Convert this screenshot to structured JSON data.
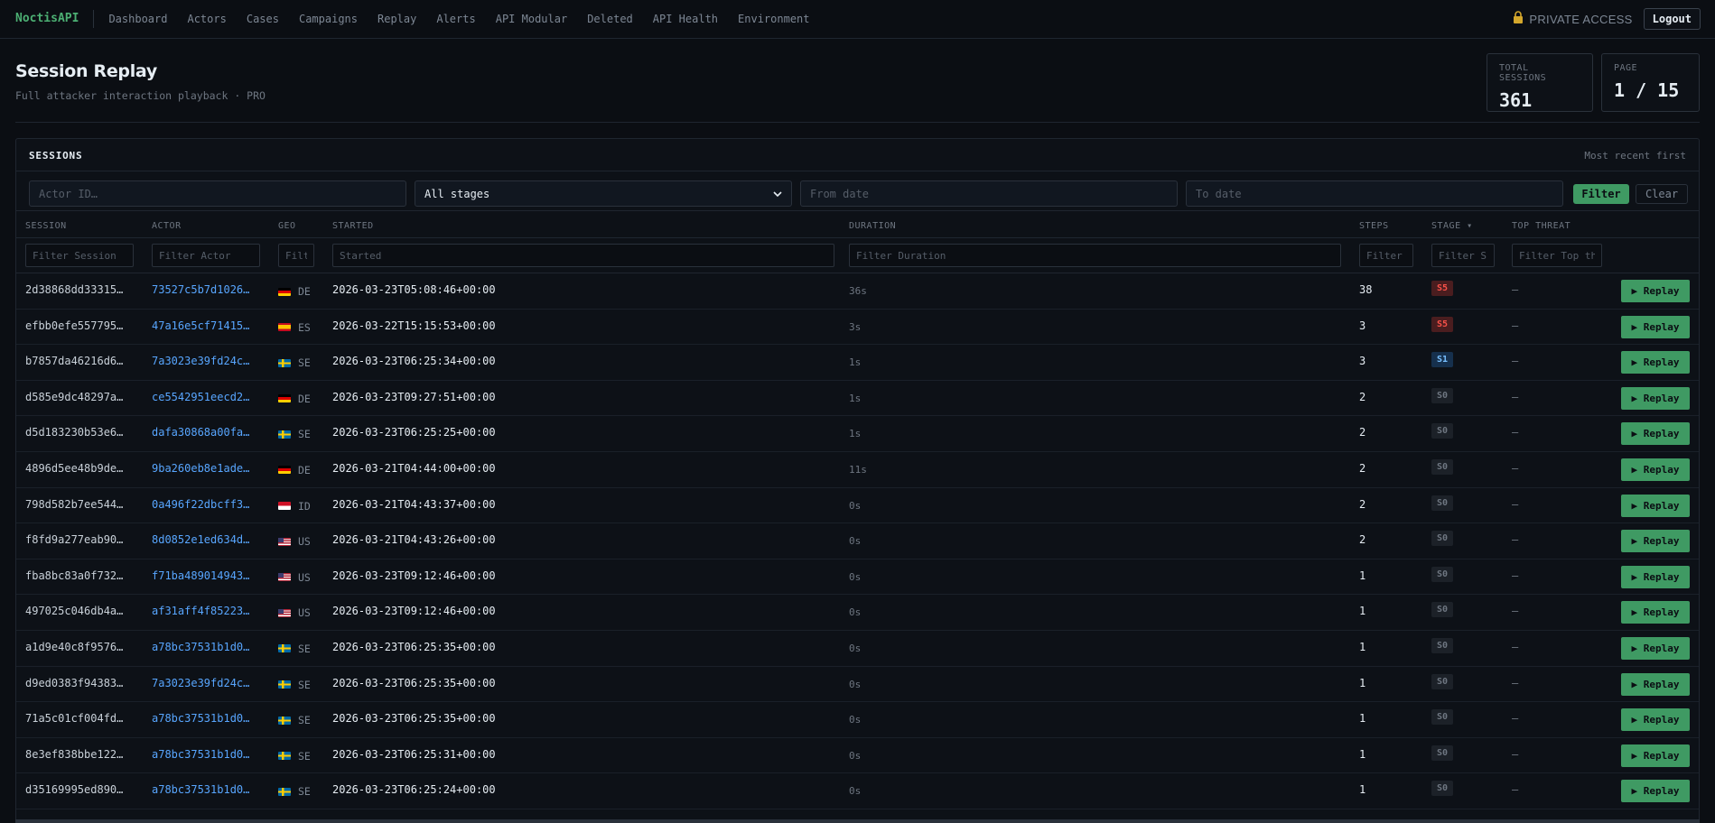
{
  "nav": {
    "brand": "NoctisAPI",
    "links": [
      "Dashboard",
      "Actors",
      "Cases",
      "Campaigns",
      "Replay",
      "Alerts",
      "API Modular",
      "Deleted",
      "API Health",
      "Environment"
    ],
    "private_label": "PRIVATE ACCESS",
    "logout_label": "Logout"
  },
  "header": {
    "title": "Session Replay",
    "subtitle": "Full attacker interaction playback · PRO",
    "total_sessions_label": "TOTAL SESSIONS",
    "total_sessions_value": "361",
    "page_label": "PAGE",
    "page_value": "1 / 15"
  },
  "panel": {
    "title": "SESSIONS",
    "note": "Most recent first",
    "actor_placeholder": "Actor ID…",
    "stage_select": "All stages",
    "from_placeholder": "From date",
    "to_placeholder": "To date",
    "filter_label": "Filter",
    "clear_label": "Clear"
  },
  "table": {
    "headers": {
      "session": "SESSION",
      "actor": "ACTOR",
      "geo": "GEO",
      "started": "STARTED",
      "duration": "DURATION",
      "steps": "STEPS",
      "stage": "STAGE ▾",
      "top_threat": "TOP THREAT"
    },
    "column_filters": {
      "session": "Filter Session",
      "actor": "Filter Actor",
      "geo": "Filt",
      "started": "Started",
      "duration": "Filter Duration",
      "steps": "Filter",
      "stage": "Filter S",
      "top_threat": "Filter Top th"
    },
    "replay_label": "▶ Replay",
    "rows": [
      {
        "session": "2d38868dd33315…",
        "actor": "73527c5b7d1026…",
        "geo": "DE",
        "started": "2026-03-23T05:08:46+00:00",
        "duration": "36s",
        "steps": "38",
        "stage": "S5",
        "threat": "—"
      },
      {
        "session": "efbb0efe557795…",
        "actor": "47a16e5cf71415…",
        "geo": "ES",
        "started": "2026-03-22T15:15:53+00:00",
        "duration": "3s",
        "steps": "3",
        "stage": "S5",
        "threat": "—"
      },
      {
        "session": "b7857da46216d6…",
        "actor": "7a3023e39fd24c…",
        "geo": "SE",
        "started": "2026-03-23T06:25:34+00:00",
        "duration": "1s",
        "steps": "3",
        "stage": "S1",
        "threat": "—"
      },
      {
        "session": "d585e9dc48297a…",
        "actor": "ce5542951eecd2…",
        "geo": "DE",
        "started": "2026-03-23T09:27:51+00:00",
        "duration": "1s",
        "steps": "2",
        "stage": "S0",
        "threat": "—"
      },
      {
        "session": "d5d183230b53e6…",
        "actor": "dafa30868a00fa…",
        "geo": "SE",
        "started": "2026-03-23T06:25:25+00:00",
        "duration": "1s",
        "steps": "2",
        "stage": "S0",
        "threat": "—"
      },
      {
        "session": "4896d5ee48b9de…",
        "actor": "9ba260eb8e1ade…",
        "geo": "DE",
        "started": "2026-03-21T04:44:00+00:00",
        "duration": "11s",
        "steps": "2",
        "stage": "S0",
        "threat": "—"
      },
      {
        "session": "798d582b7ee544…",
        "actor": "0a496f22dbcff3…",
        "geo": "ID",
        "started": "2026-03-21T04:43:37+00:00",
        "duration": "0s",
        "steps": "2",
        "stage": "S0",
        "threat": "—"
      },
      {
        "session": "f8fd9a277eab90…",
        "actor": "8d0852e1ed634d…",
        "geo": "US",
        "started": "2026-03-21T04:43:26+00:00",
        "duration": "0s",
        "steps": "2",
        "stage": "S0",
        "threat": "—"
      },
      {
        "session": "fba8bc83a0f732…",
        "actor": "f71ba489014943…",
        "geo": "US",
        "started": "2026-03-23T09:12:46+00:00",
        "duration": "0s",
        "steps": "1",
        "stage": "S0",
        "threat": "—"
      },
      {
        "session": "497025c046db4a…",
        "actor": "af31aff4f85223…",
        "geo": "US",
        "started": "2026-03-23T09:12:46+00:00",
        "duration": "0s",
        "steps": "1",
        "stage": "S0",
        "threat": "—"
      },
      {
        "session": "a1d9e40c8f9576…",
        "actor": "a78bc37531b1d0…",
        "geo": "SE",
        "started": "2026-03-23T06:25:35+00:00",
        "duration": "0s",
        "steps": "1",
        "stage": "S0",
        "threat": "—"
      },
      {
        "session": "d9ed0383f94383…",
        "actor": "7a3023e39fd24c…",
        "geo": "SE",
        "started": "2026-03-23T06:25:35+00:00",
        "duration": "0s",
        "steps": "1",
        "stage": "S0",
        "threat": "—"
      },
      {
        "session": "71a5c01cf004fd…",
        "actor": "a78bc37531b1d0…",
        "geo": "SE",
        "started": "2026-03-23T06:25:35+00:00",
        "duration": "0s",
        "steps": "1",
        "stage": "S0",
        "threat": "—"
      },
      {
        "session": "8e3ef838bbe122…",
        "actor": "a78bc37531b1d0…",
        "geo": "SE",
        "started": "2026-03-23T06:25:31+00:00",
        "duration": "0s",
        "steps": "1",
        "stage": "S0",
        "threat": "—"
      },
      {
        "session": "d35169995ed890…",
        "actor": "a78bc37531b1d0…",
        "geo": "SE",
        "started": "2026-03-23T06:25:24+00:00",
        "duration": "0s",
        "steps": "1",
        "stage": "S0",
        "threat": "—"
      }
    ]
  },
  "colors": {
    "accent": "#3f9a63",
    "link": "#58a6ff",
    "stage_s5_bg": "#4a1d1f",
    "stage_s5_fg": "#f85149",
    "stage_s1_bg": "#16304d",
    "stage_s1_fg": "#79c0ff",
    "stage_s0_bg": "#1c2128",
    "stage_s0_fg": "#6e7681"
  }
}
